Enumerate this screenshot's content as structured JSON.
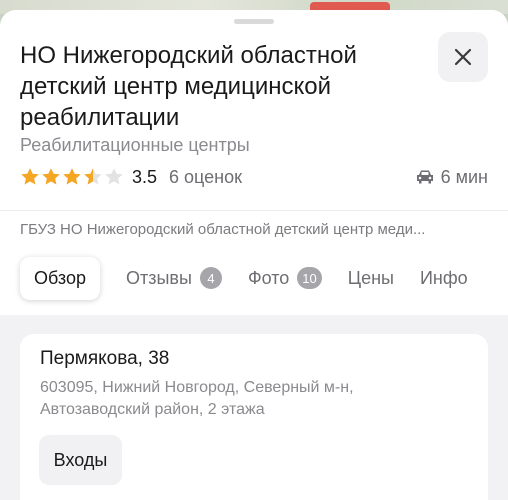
{
  "place": {
    "title": "НО Нижегородский областной детский центр медицинской реабилитации",
    "category": "Реабилитационные центры",
    "rating_value": "3.5",
    "rating_count": "6 оценок",
    "rating_stars": 3.5,
    "travel_time": "6 мин",
    "legal_name": "ГБУЗ НО Нижегородский областной детский центр меди..."
  },
  "icons": {
    "close": "close-icon",
    "car": "car-icon",
    "star": "star-icon"
  },
  "colors": {
    "star_filled": "#f5a623",
    "star_empty": "#e3e3e3",
    "badge": "#a5a5aa"
  },
  "tabs": [
    {
      "label": "Обзор",
      "active": true
    },
    {
      "label": "Отзывы",
      "badge": "4"
    },
    {
      "label": "Фото",
      "badge": "10"
    },
    {
      "label": "Цены"
    },
    {
      "label": "Инфо"
    }
  ],
  "address": {
    "street": "Пермякова, 38",
    "detail": "603095, Нижний Новгород, Северный м-н, Автозаводский район, 2 этажа",
    "entrances_label": "Входы"
  }
}
